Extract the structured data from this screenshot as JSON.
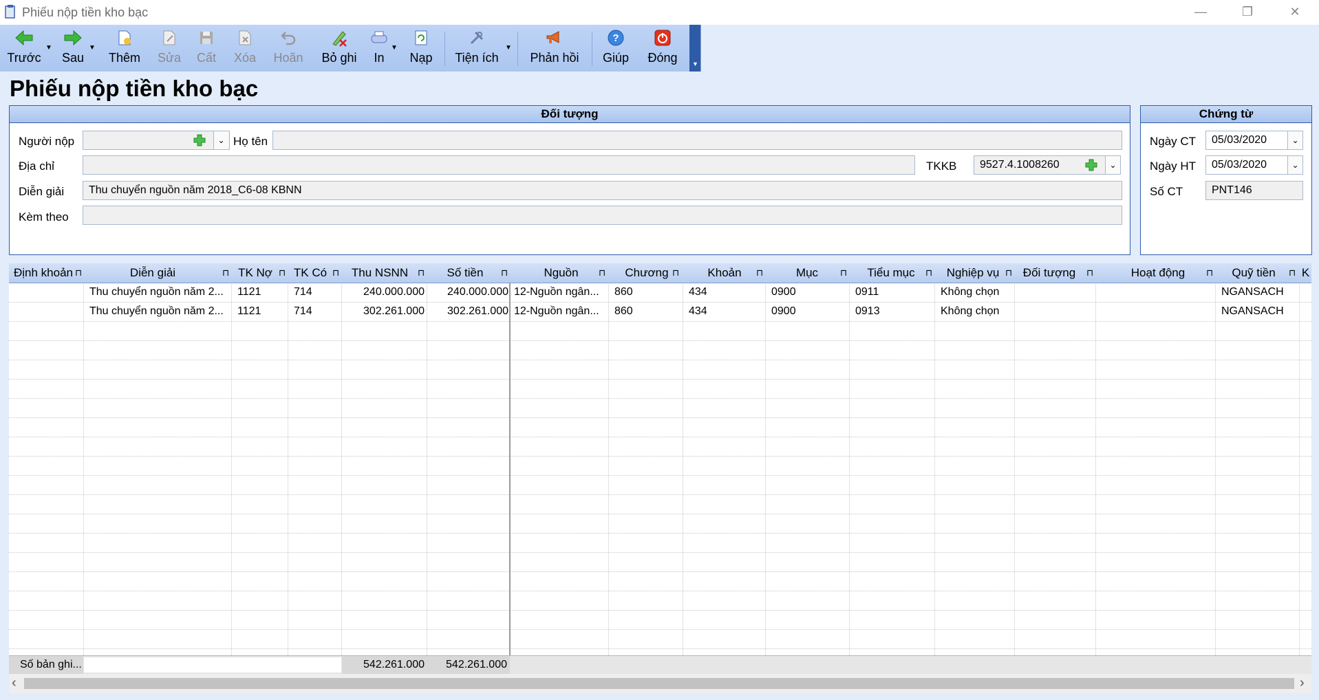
{
  "window": {
    "title": "Phiếu nộp tiền kho bạc",
    "minimize": "—",
    "restore": "❐",
    "close": "✕"
  },
  "toolbar": [
    {
      "label": "Trước",
      "icon": "arrow-left-icon",
      "enabled": true,
      "dropdown": true
    },
    {
      "label": "Sau",
      "icon": "arrow-right-icon",
      "enabled": true,
      "dropdown": true
    },
    {
      "label": "Thêm",
      "icon": "add-document-icon",
      "enabled": true
    },
    {
      "label": "Sửa",
      "icon": "edit-document-icon",
      "enabled": false
    },
    {
      "label": "Cất",
      "icon": "save-icon",
      "enabled": false
    },
    {
      "label": "Xóa",
      "icon": "delete-document-icon",
      "enabled": false
    },
    {
      "label": "Hoãn",
      "icon": "undo-icon",
      "enabled": false
    },
    {
      "label": "Bỏ ghi",
      "icon": "unpost-icon",
      "enabled": true
    },
    {
      "label": "In",
      "icon": "print-icon",
      "enabled": true,
      "dropdown": true
    },
    {
      "label": "Nạp",
      "icon": "reload-icon",
      "enabled": true
    },
    {
      "label": "Tiện ích",
      "icon": "tools-icon",
      "enabled": true,
      "dropdown": true
    },
    {
      "label": "Phản hồi",
      "icon": "megaphone-icon",
      "enabled": true
    },
    {
      "label": "Giúp",
      "icon": "help-icon",
      "enabled": true
    },
    {
      "label": "Đóng",
      "icon": "power-icon",
      "enabled": true
    }
  ],
  "page_title": "Phiếu nộp tiền kho bạc",
  "doi_tuong": {
    "header": "Đối tượng",
    "nguoi_nop_label": "Người nộp",
    "nguoi_nop_value": "",
    "ho_ten_label": "Họ tên",
    "ho_ten_value": "",
    "dia_chi_label": "Địa chỉ",
    "dia_chi_value": "",
    "tkkb_label": "TKKB",
    "tkkb_value": "9527.4.1008260",
    "dien_giai_label": "Diễn giải",
    "dien_giai_value": "Thu chuyển nguồn năm 2018_C6-08 KBNN",
    "kem_theo_label": "Kèm theo",
    "kem_theo_value": ""
  },
  "chung_tu": {
    "header": "Chứng từ",
    "ngay_ct_label": "Ngày CT",
    "ngay_ct_value": "05/03/2020",
    "ngay_ht_label": "Ngày HT",
    "ngay_ht_value": "05/03/2020",
    "so_ct_label": "Số CT",
    "so_ct_value": "PNT146"
  },
  "grid": {
    "columns": [
      "Định khoản",
      "Diễn giải",
      "TK Nợ",
      "TK Có",
      "Thu NSNN",
      "Số tiền",
      "Nguồn",
      "Chương",
      "Khoản",
      "Mục",
      "Tiểu mục",
      "Nghiệp vụ",
      "Đối tượng",
      "Hoạt động",
      "Quỹ tiền",
      "K"
    ],
    "rows": [
      [
        "",
        "Thu chuyển nguồn năm 2...",
        "1121",
        "714",
        "240.000.000",
        "240.000.000",
        "12-Nguồn ngân...",
        "860",
        "434",
        "0900",
        "0911",
        "Không chọn",
        "",
        "",
        "NGANSACH",
        ""
      ],
      [
        "",
        "Thu chuyển nguồn năm 2...",
        "1121",
        "714",
        "302.261.000",
        "302.261.000",
        "12-Nguồn ngân...",
        "860",
        "434",
        "0900",
        "0913",
        "Không chọn",
        "",
        "",
        "NGANSACH",
        ""
      ]
    ],
    "footer": {
      "label": "Số bản ghi...",
      "thu_nsnn_total": "542.261.000",
      "so_tien_total": "542.261.000"
    }
  },
  "scroll": {
    "left_arrow": "‹",
    "right_arrow": "›"
  }
}
